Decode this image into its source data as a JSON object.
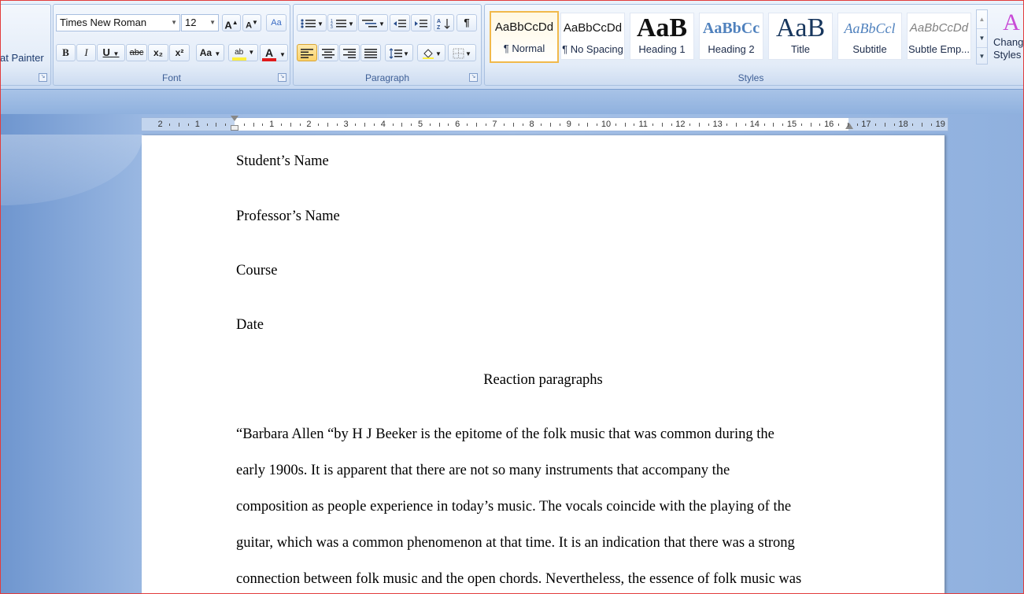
{
  "ribbon": {
    "clipboard": {
      "format_painter": "at Painter"
    },
    "font": {
      "label": "Font",
      "font_name": "Times New Roman",
      "font_size": "12",
      "grow": "A",
      "shrink": "A",
      "clear": "Aa",
      "bold": "B",
      "italic": "I",
      "underline": "U",
      "strike": "abc",
      "subscript": "x₂",
      "superscript": "x²",
      "change_case": "Aa",
      "highlight": "ab",
      "font_color": "A",
      "highlight_color": "#ffef3b",
      "font_color_value": "#e01b1b"
    },
    "paragraph": {
      "label": "Paragraph",
      "show_marks": "¶"
    },
    "styles": {
      "label": "Styles",
      "items": [
        {
          "sample": "AaBbCcDd",
          "name": "¶ Normal"
        },
        {
          "sample": "AaBbCcDd",
          "name": "¶ No Spacing"
        },
        {
          "sample": "AaB",
          "name": "Heading 1"
        },
        {
          "sample": "AaBbCc",
          "name": "Heading 2"
        },
        {
          "sample": "AaB",
          "name": "Title"
        },
        {
          "sample": "AaBbCcl",
          "name": "Subtitle"
        },
        {
          "sample": "AaBbCcDd",
          "name": "Subtle Emp..."
        }
      ],
      "change_styles": "Change Styles"
    }
  },
  "ruler": {
    "left_ticks": [
      "2",
      "1"
    ],
    "right_ticks": [
      "1",
      "2",
      "3",
      "4",
      "5",
      "6",
      "7",
      "8",
      "9",
      "10",
      "11",
      "12",
      "13",
      "14",
      "15",
      "16",
      "17",
      "18",
      "19"
    ]
  },
  "document": {
    "student": "Student’s Name",
    "professor": "Professor’s Name",
    "course": "Course",
    "date": "Date",
    "title": "Reaction paragraphs",
    "body_lines": [
      "“Barbara Allen “by H J Beeker is the epitome of the folk music that was common during the",
      "early 1900s. It is apparent that there are not so many instruments that accompany the",
      "composition as people experience in today’s music. The vocals coincide with the playing of the",
      "guitar, which was a common phenomenon at that time. It is an indication that there was a strong",
      "connection between folk music and the open chords. Nevertheless, the essence of folk music was"
    ]
  }
}
